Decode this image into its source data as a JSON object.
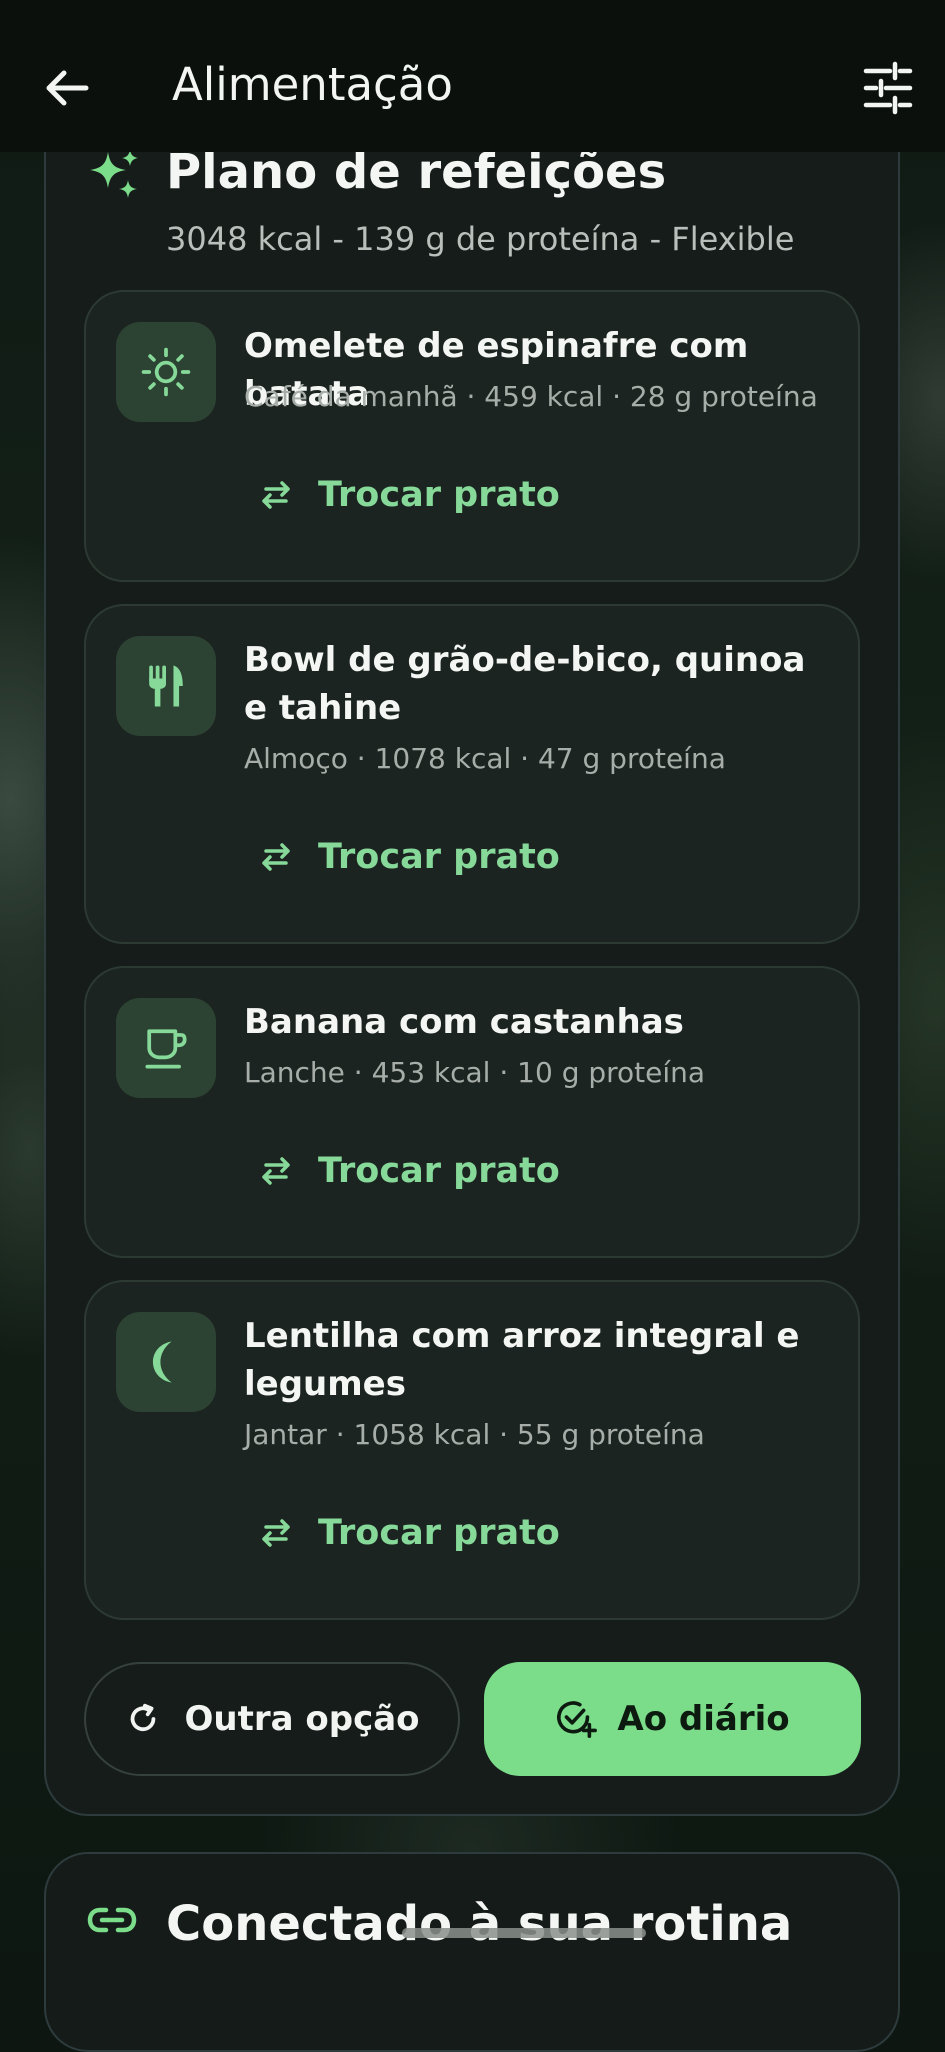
{
  "appbar": {
    "title": "Alimentação",
    "back_icon": "arrow-left-icon",
    "filter_icon": "sliders-icon"
  },
  "plan": {
    "title": "Plano de refeições",
    "subtitle": "3048 kcal - 139 g de proteína - Flexible",
    "icon": "sparkle-icon"
  },
  "meals": [
    {
      "name": "Omelete de espinafre com batata",
      "meta": "Café da manhã · 459 kcal · 28 g proteína",
      "icon": "sun-icon",
      "action": "Trocar prato"
    },
    {
      "name": "Bowl de grão-de-bico, quinoa e tahine",
      "meta": "Almoço · 1078 kcal · 47 g proteína",
      "icon": "utensils-icon",
      "action": "Trocar prato"
    },
    {
      "name": "Banana com castanhas",
      "meta": "Lanche · 453 kcal · 10 g proteína",
      "icon": "cup-icon",
      "action": "Trocar prato"
    },
    {
      "name": "Lentilha com arroz integral e legumes",
      "meta": "Jantar · 1058 kcal · 55 g proteína",
      "icon": "moon-icon",
      "action": "Trocar prato"
    }
  ],
  "actions": {
    "other_option": "Outra opção",
    "to_diary": "Ao diário"
  },
  "routine": {
    "title": "Conectado à sua rotina",
    "icon": "link-icon"
  },
  "colors": {
    "accent": "#7bdc8a",
    "card_bg": "#1c2421",
    "panel_bg": "#161c1a"
  }
}
